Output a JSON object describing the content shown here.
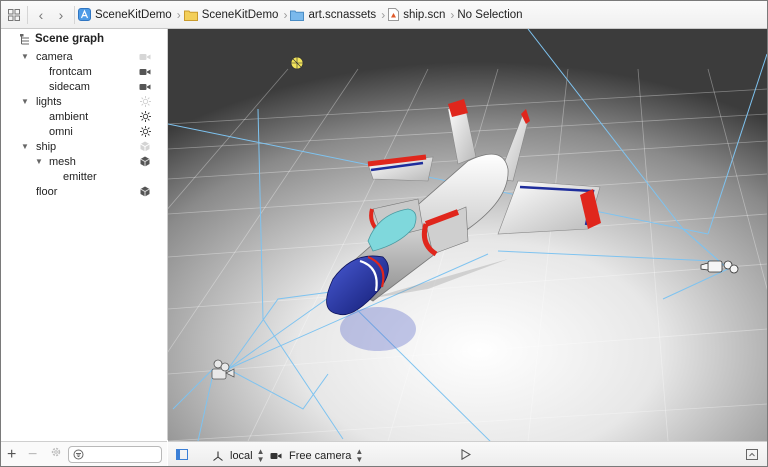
{
  "jumpbar": {
    "breadcrumbs": [
      {
        "label": "SceneKitDemo",
        "icon": "app-icon"
      },
      {
        "label": "SceneKitDemo",
        "icon": "folder-icon"
      },
      {
        "label": "art.scnassets",
        "icon": "folder-icon"
      },
      {
        "label": "ship.scn",
        "icon": "scene-file-icon"
      },
      {
        "label": "No Selection"
      }
    ]
  },
  "sidebar": {
    "title": "Scene graph",
    "items": [
      {
        "label": "camera",
        "icon": "camera-icon"
      },
      {
        "label": "frontcam",
        "icon": "camera-icon"
      },
      {
        "label": "sidecam",
        "icon": "camera-icon"
      },
      {
        "label": "lights",
        "icon": "light-icon"
      },
      {
        "label": "ambient",
        "icon": "light-icon"
      },
      {
        "label": "omni",
        "icon": "light-icon"
      },
      {
        "label": "ship",
        "icon": "geometry-icon"
      },
      {
        "label": "mesh",
        "icon": "geometry-icon"
      },
      {
        "label": "emitter",
        "icon": ""
      },
      {
        "label": "floor",
        "icon": "geometry-icon"
      }
    ],
    "filter_placeholder": ""
  },
  "toolbar": {
    "coordinate_space": "local",
    "camera": "Free camera"
  },
  "colors": {
    "accent": "#3b7fd6",
    "ship_nose": "#1e2d9c",
    "ship_red": "#e0261c",
    "ship_cockpit": "#7fd8dc",
    "gizmo_lines": "#7ec3f0"
  }
}
